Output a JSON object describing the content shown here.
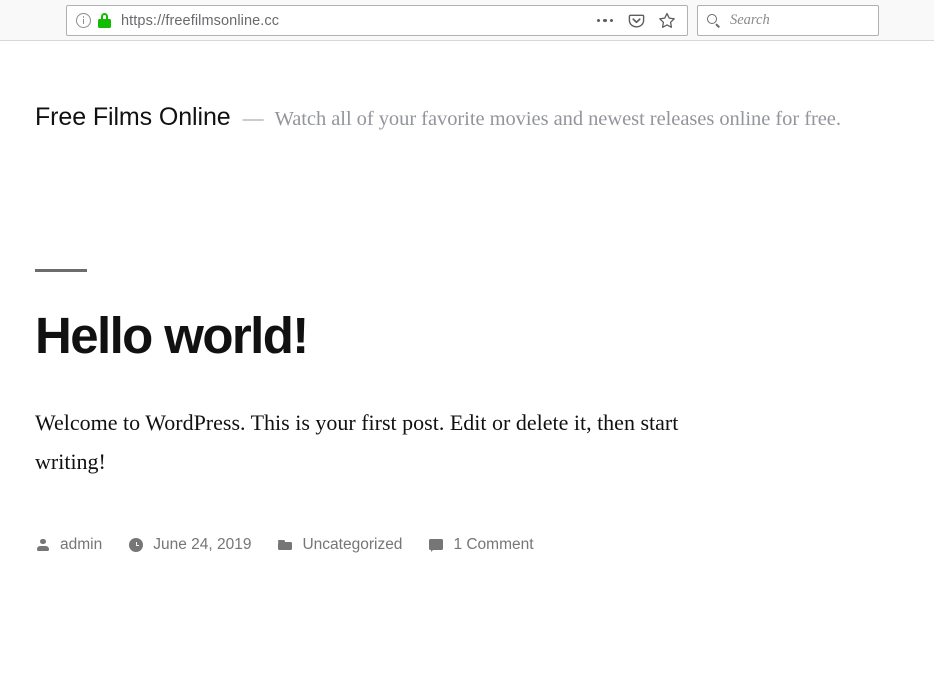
{
  "browser": {
    "url": "https://freefilmsonline.cc",
    "identity_icon": "info-icon",
    "lock_icon": "lock-icon",
    "lock_color": "#12bc00",
    "page_actions_icon": "ellipsis-icon",
    "pocket_icon": "pocket-icon",
    "bookmark_icon": "star-icon",
    "search": {
      "icon": "search-icon",
      "placeholder": "Search",
      "value": ""
    }
  },
  "site": {
    "title": "Free Films Online",
    "separator": "—",
    "description": "Watch all of your favorite movies and newest releases online for free."
  },
  "post": {
    "title": "Hello world!",
    "body": "Welcome to WordPress. This is your first post. Edit or delete it, then start writing!",
    "meta": {
      "author": {
        "icon": "person-icon",
        "label": "admin"
      },
      "date": {
        "icon": "clock-icon",
        "label": "June 24, 2019"
      },
      "category": {
        "icon": "folder-icon",
        "label": "Uncategorized"
      },
      "comments": {
        "icon": "comment-icon",
        "label": "1 Comment"
      }
    }
  },
  "colors": {
    "accent_lock_green": "#12bc00",
    "text_primary": "#111111",
    "text_muted": "#767676",
    "tagline_gray": "#93959c",
    "toolbar_bg": "#f9f9fa"
  }
}
